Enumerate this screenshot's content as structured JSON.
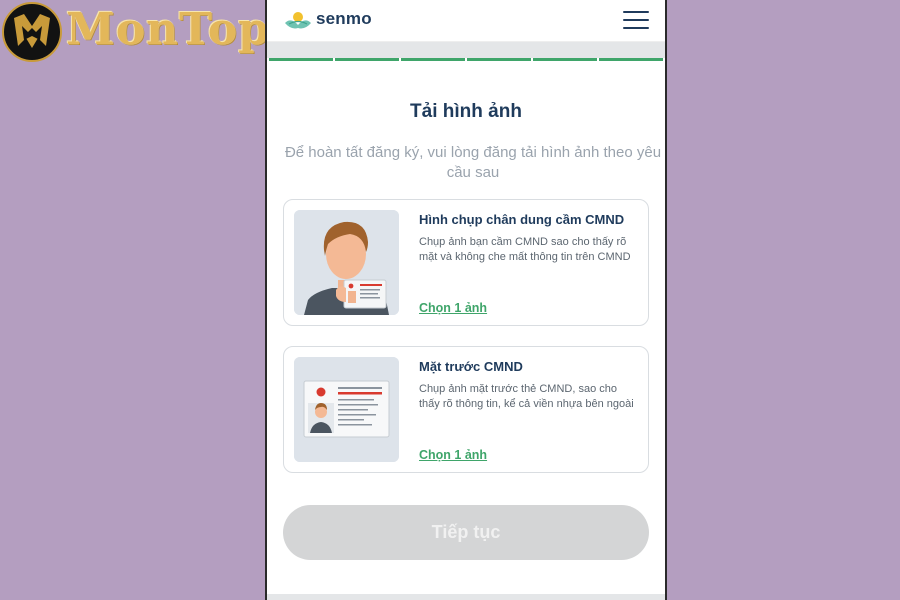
{
  "watermark": {
    "text": "MonTop",
    "icon": "montop-logo-icon",
    "accent": "#e3b75a"
  },
  "header": {
    "brand": "senmo",
    "brand_icon": "lotus-icon",
    "menu_icon": "hamburger-menu-icon"
  },
  "progress": {
    "steps_completed": 6,
    "steps_total": 6,
    "color": "#3fa56a"
  },
  "page": {
    "title": "Tải hình ảnh",
    "subtitle": "Để hoàn tất đăng ký, vui lòng đăng tải hình ảnh theo yêu cầu sau"
  },
  "cards": [
    {
      "title": "Hình chụp chân dung cầm CMND",
      "description": "Chụp ảnh bạn cầm CMND sao cho thấy rõ mặt và không che mất thông tin trên CMND",
      "link": "Chọn 1 ảnh",
      "illustration": "person-holding-id-illustration"
    },
    {
      "title": "Mặt trước CMND",
      "description": "Chụp ảnh mặt trước thẻ CMND, sao cho thấy rõ thông tin, kể cả viền nhựa bên ngoài",
      "link": "Chọn 1 ảnh",
      "illustration": "id-card-front-illustration"
    }
  ],
  "cta": {
    "label": "Tiếp tục",
    "disabled": true
  },
  "colors": {
    "brand_navy": "#1f3b5c",
    "accent_green": "#3fa56a",
    "background": "#b49ec0"
  }
}
